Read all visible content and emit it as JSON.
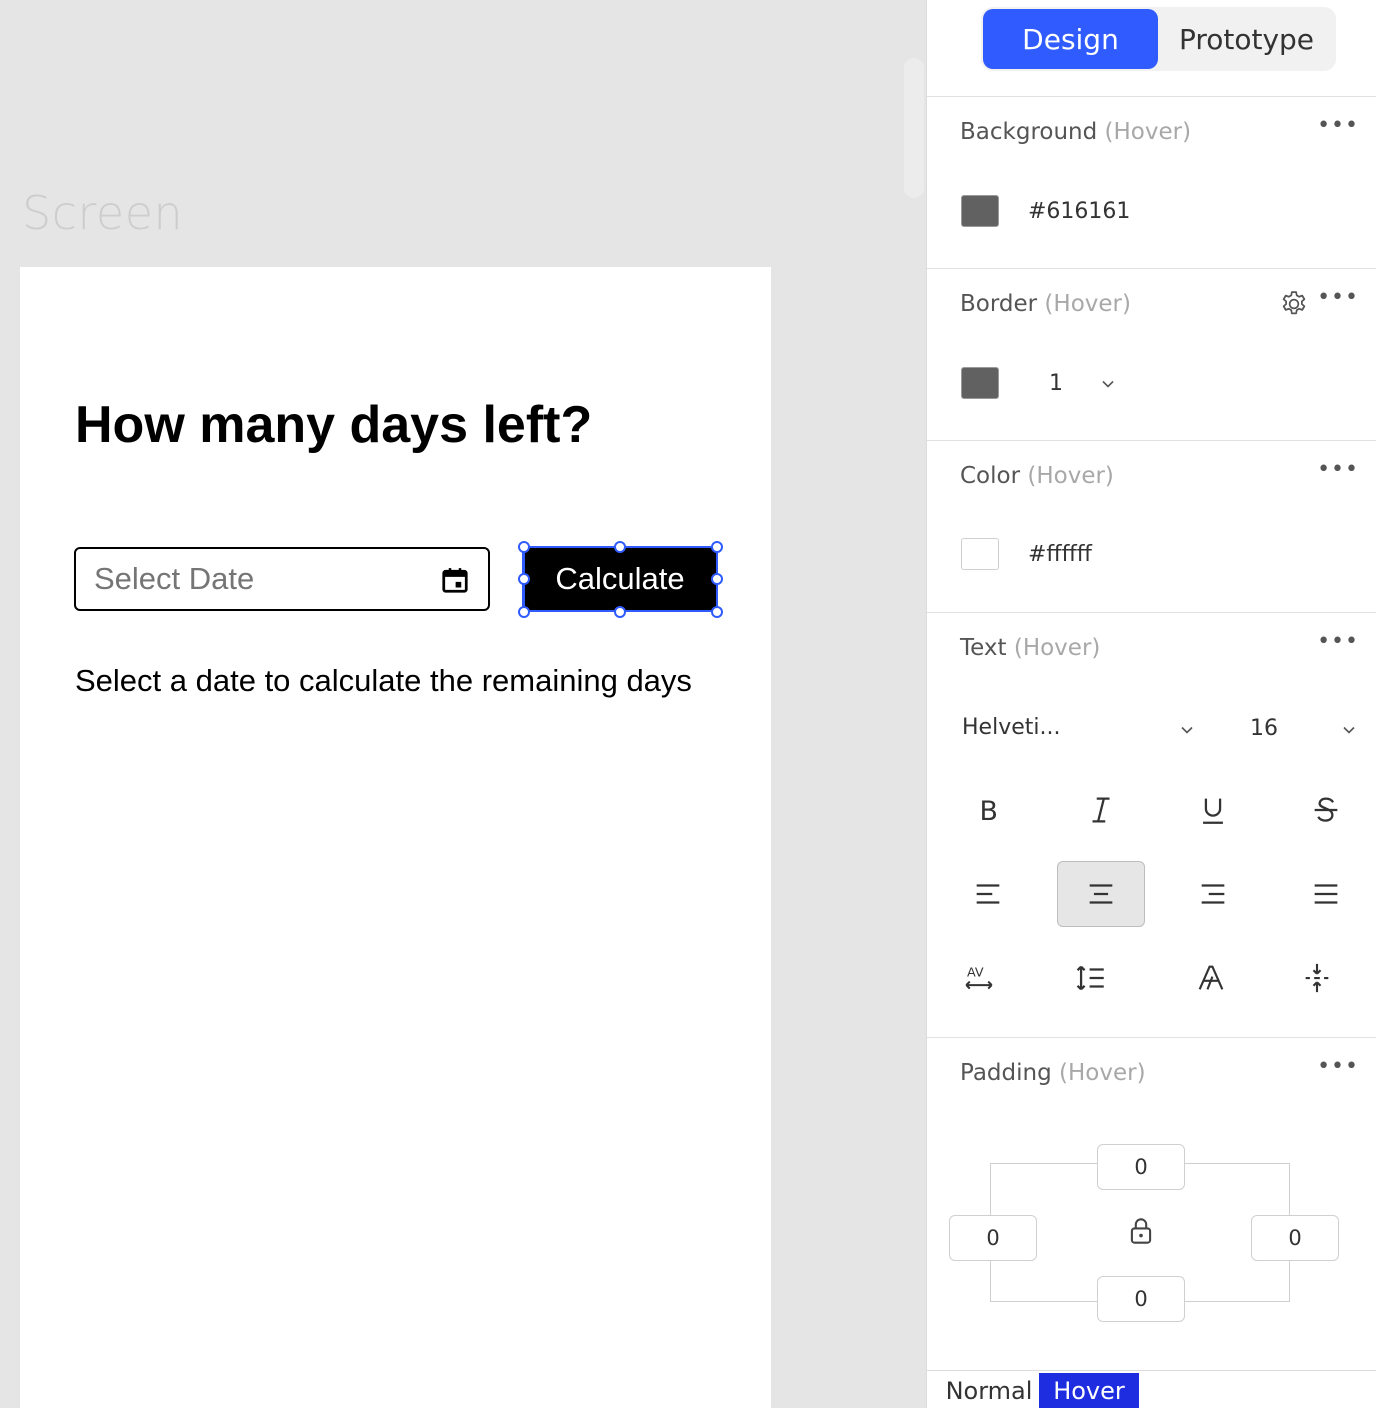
{
  "canvas": {
    "frame_label": "Screen",
    "app": {
      "title": "How many days left?",
      "date_placeholder": "Select Date",
      "calculate_label": "Calculate",
      "helper_text": "Select a date to calculate the remaining days"
    }
  },
  "panel": {
    "mode_tabs": [
      "Design",
      "Prototype"
    ],
    "active_mode": "Design",
    "state_label": "(Hover)",
    "more_label": "•••",
    "background": {
      "title": "Background",
      "color": "#616161",
      "value": "#616161"
    },
    "border": {
      "title": "Border",
      "color": "#616161",
      "width": "1"
    },
    "color": {
      "title": "Color",
      "color": "#ffffff",
      "value": "#ffffff"
    },
    "text": {
      "title": "Text",
      "font": "Helveti...",
      "size": "16",
      "style_buttons": [
        "bold-icon",
        "italic-icon",
        "underline-icon",
        "strikethrough-icon"
      ],
      "align_buttons": [
        "align-left-icon",
        "align-center-icon",
        "align-right-icon",
        "align-justify-icon"
      ],
      "active_align": "align-center-icon",
      "extra_buttons": [
        "letter-spacing-icon",
        "line-height-icon",
        "text-outline-icon",
        "vertical-spacing-icon"
      ]
    },
    "padding": {
      "title": "Padding",
      "top": "0",
      "right": "0",
      "bottom": "0",
      "left": "0"
    },
    "states": [
      "Normal",
      "Hover"
    ],
    "active_state": "Hover"
  }
}
